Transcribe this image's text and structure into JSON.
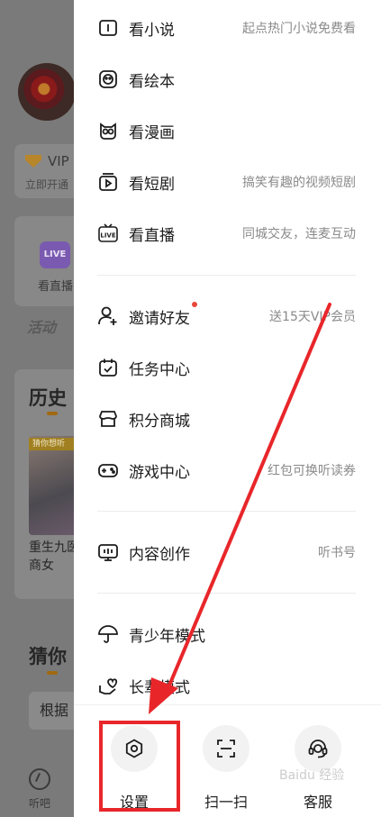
{
  "background": {
    "vip_text": "VIP",
    "vip_sub": "立即开通",
    "live_icon": "LIVE",
    "live_text": "看直播",
    "activity": "活动",
    "history": "历史",
    "book_tag": "猜你想听",
    "book_title": "重生九医商女",
    "guess": "猜你",
    "basis": "根据",
    "nav_label": "听吧"
  },
  "menu": {
    "group1": [
      {
        "icon": "book-icon",
        "label": "看小说",
        "desc": "起点热门小说免费看"
      },
      {
        "icon": "face-icon",
        "label": "看绘本",
        "desc": ""
      },
      {
        "icon": "owl-icon",
        "label": "看漫画",
        "desc": ""
      },
      {
        "icon": "play-box-icon",
        "label": "看短剧",
        "desc": "搞笑有趣的视频短剧"
      },
      {
        "icon": "live-tv-icon",
        "label": "看直播",
        "desc": "同城交友，连麦互动"
      }
    ],
    "group2": [
      {
        "icon": "add-user-icon",
        "label": "邀请好友",
        "desc": "送15天VIP会员"
      },
      {
        "icon": "calendar-check-icon",
        "label": "任务中心",
        "desc": ""
      },
      {
        "icon": "store-icon",
        "label": "积分商城",
        "desc": ""
      },
      {
        "icon": "gamepad-icon",
        "label": "游戏中心",
        "desc": "红包可换听读券"
      }
    ],
    "group3": [
      {
        "icon": "creator-icon",
        "label": "内容创作",
        "desc": "听书号"
      }
    ],
    "group4": [
      {
        "icon": "umbrella-icon",
        "label": "青少年模式",
        "desc": ""
      },
      {
        "icon": "heart-hands-icon",
        "label": "长辈模式",
        "desc": ""
      }
    ]
  },
  "bottom": {
    "settings": "设置",
    "scan": "扫一扫",
    "service": "客服"
  },
  "watermark": "Baidu 经验",
  "colors": {
    "annotation_red": "#e8262a",
    "badge_red": "#e8463c",
    "dim_overlay": "#7a7a7a"
  }
}
